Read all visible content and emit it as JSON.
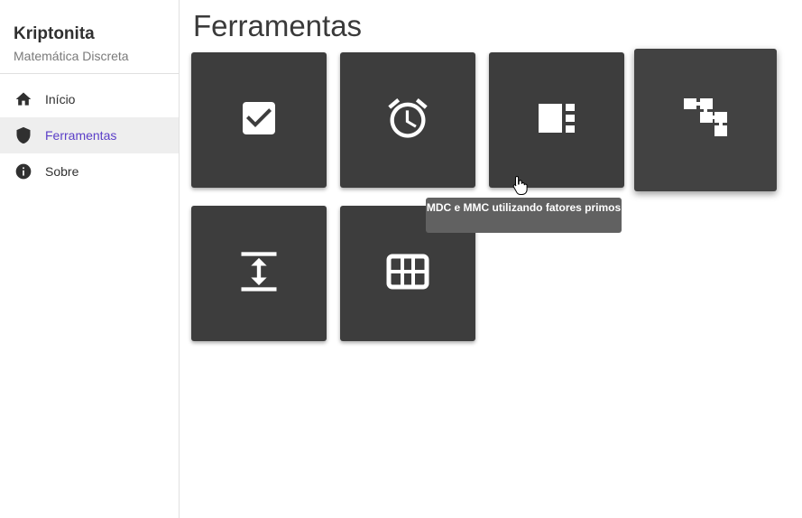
{
  "sidebar": {
    "brand_title": "Kriptonita",
    "brand_subtitle": "Matemática Discreta",
    "items": [
      {
        "label": "Início",
        "icon": "home-icon",
        "active": false
      },
      {
        "label": "Ferramentas",
        "icon": "shield-icon",
        "active": true
      },
      {
        "label": "Sobre",
        "icon": "info-icon",
        "active": false
      }
    ]
  },
  "main": {
    "title": "Ferramentas",
    "tools": [
      {
        "icon": "checkbox-icon"
      },
      {
        "icon": "alarm-icon"
      },
      {
        "icon": "view-column-icon"
      },
      {
        "icon": "hierarchy-icon"
      },
      {
        "icon": "vertical-align-icon"
      },
      {
        "icon": "grid-icon"
      }
    ],
    "tooltip": "MDC e MMC utilizando fatores primos"
  },
  "colors": {
    "accent": "#5b3fc8",
    "tile": "#3d3d3d",
    "tooltip": "#616161"
  }
}
